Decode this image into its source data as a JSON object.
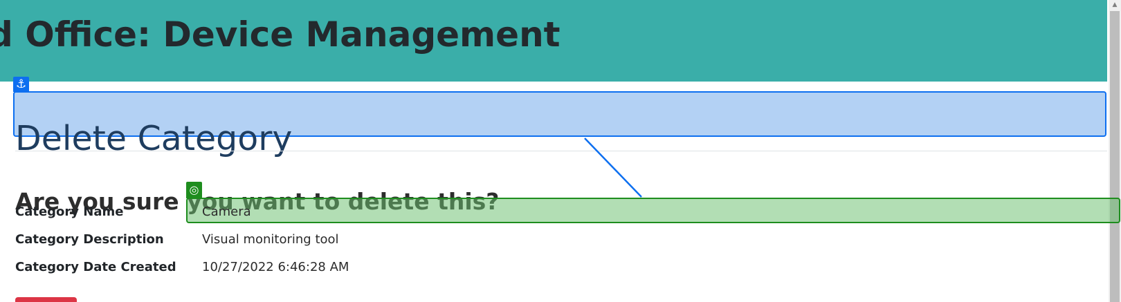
{
  "header": {
    "title": "d Office: Device Management"
  },
  "main": {
    "heading": "Delete Category",
    "confirmation": "Are you sure you want to delete this?",
    "details": [
      {
        "label": "Category Name",
        "value": "Camera"
      },
      {
        "label": "Category Description",
        "value": "Visual monitoring tool"
      },
      {
        "label": "Category Date Created",
        "value": "10/27/2022 6:46:28 AM"
      }
    ],
    "delete_button_label": ""
  },
  "annotations": {
    "anchor_icon": "anchor-icon",
    "target_icon": "target-icon",
    "anchor_glyph": "⚓",
    "target_glyph": "◎",
    "anchor_color": "#0d6ff0",
    "target_color": "#1e8d1e"
  },
  "scrollbar": {
    "up_arrow": "▲"
  },
  "colors": {
    "header": "#3aaea9",
    "delete": "#dc3545"
  }
}
